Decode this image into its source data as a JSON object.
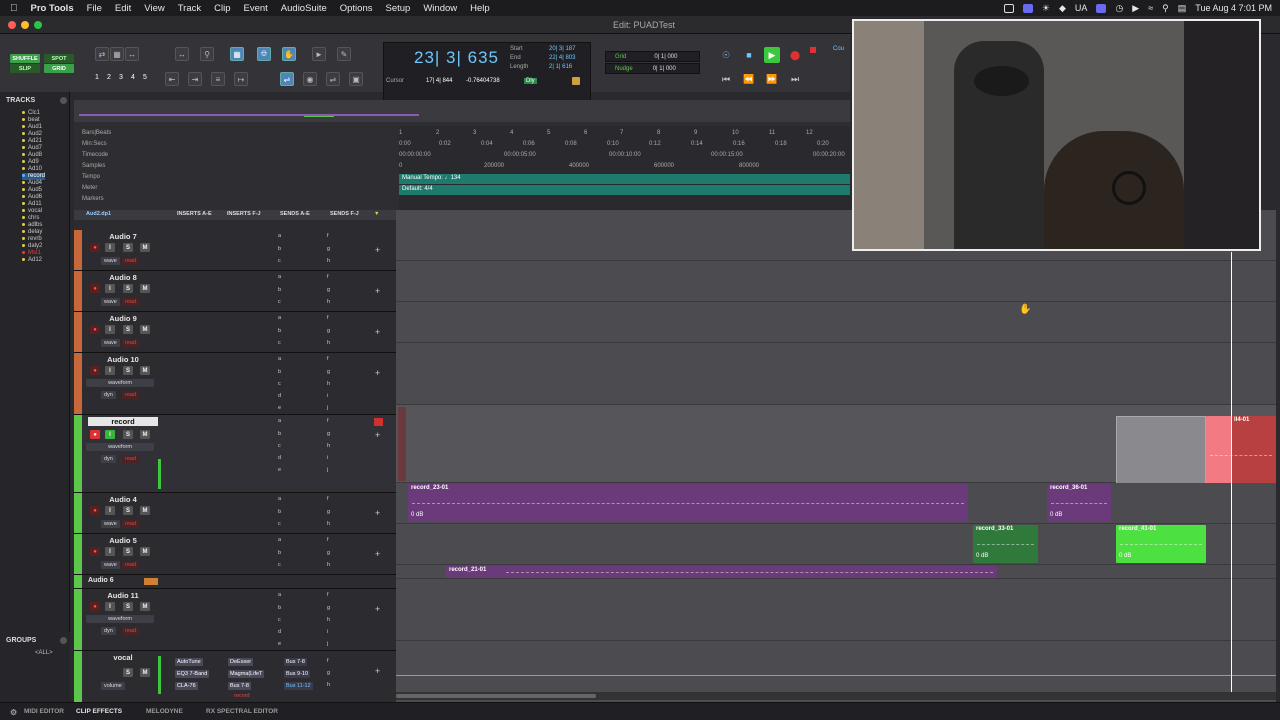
{
  "menubar": {
    "app": "Pro Tools",
    "items": [
      "File",
      "Edit",
      "View",
      "Track",
      "Clip",
      "Event",
      "AudioSuite",
      "Options",
      "Setup",
      "Window",
      "Help"
    ],
    "locale": "UA",
    "clock": "Tue Aug 4  7:01 PM"
  },
  "window": {
    "title": "Edit: PUADTest"
  },
  "toolbar": {
    "modes": [
      "SHUFFLE",
      "SPOT",
      "SLIP",
      "GRID"
    ],
    "zoom_presets": [
      "1",
      "2",
      "3",
      "4",
      "5"
    ],
    "main_counter": "23| 3| 635",
    "sel_labels": [
      "Start",
      "End",
      "Length"
    ],
    "sel_values": [
      "20| 3| 187",
      "22| 4| 803",
      "2| 1| 616"
    ],
    "cursor_label": "Cursor",
    "cursor_value": "17| 4| 844",
    "cursor_db": "-0.76404738",
    "dly": "Dly",
    "grid_label": "Grid",
    "grid_value": "0| 1| 000",
    "nudge_label": "Nudge",
    "nudge_value": "0| 1| 000",
    "cou": "Cou"
  },
  "tracks_list": {
    "header": "TRACKS",
    "items": [
      {
        "name": "Clc1",
        "color": "#e0d040"
      },
      {
        "name": "beat",
        "color": "#e0d040"
      },
      {
        "name": "Aud1",
        "color": "#e0d040"
      },
      {
        "name": "Aud2",
        "color": "#e0d040"
      },
      {
        "name": "Ad21",
        "color": "#e0d040"
      },
      {
        "name": "Aud7",
        "color": "#e0d040"
      },
      {
        "name": "Aud8",
        "color": "#e0d040"
      },
      {
        "name": "Ad9",
        "color": "#e0d040"
      },
      {
        "name": "Ad10",
        "color": "#e0d040"
      },
      {
        "name": "record",
        "color": "#5ab0ff"
      },
      {
        "name": "Aud4",
        "color": "#e0d040"
      },
      {
        "name": "Aud5",
        "color": "#e0d040"
      },
      {
        "name": "Aud6",
        "color": "#e0d040"
      },
      {
        "name": "Ad11",
        "color": "#e0d040"
      },
      {
        "name": "vocal",
        "color": "#e0d040"
      },
      {
        "name": "chrs",
        "color": "#e0d040"
      },
      {
        "name": "adlbs",
        "color": "#e0d040"
      },
      {
        "name": "delay",
        "color": "#e0d040"
      },
      {
        "name": "revrb",
        "color": "#e0d040"
      },
      {
        "name": "daly2",
        "color": "#e0d040"
      },
      {
        "name": "Mst1",
        "color": "#e04040"
      },
      {
        "name": "Ad12",
        "color": "#e0d040"
      }
    ]
  },
  "groups": {
    "header": "GROUPS",
    "all": "<ALL>"
  },
  "rulers": {
    "rows": [
      "Bars|Beats",
      "Min:Secs",
      "Timecode",
      "Samples",
      "Tempo",
      "Meter",
      "Markers"
    ],
    "bars": [
      "1",
      "2",
      "3",
      "4",
      "5",
      "6",
      "7",
      "8",
      "9",
      "10",
      "11",
      "12"
    ],
    "mins": [
      "0:00",
      "0:02",
      "0:04",
      "0:06",
      "0:08",
      "0:10",
      "0:12",
      "0:14",
      "0:16",
      "0:18",
      "0:20"
    ],
    "timecode": [
      "00:00:00:00",
      "00:00:05:00",
      "00:00:10:00",
      "00:00:15:00",
      "00:00:20:00"
    ],
    "samples": [
      "0",
      "200000",
      "400000",
      "600000",
      "800000"
    ],
    "tempo": "Manual Tempo: ♩134",
    "meter": "Default: 4/4"
  },
  "columns": {
    "track_header": "Aud2.dp1",
    "inserts_ae": "INSERTS A-E",
    "inserts_fj": "INSERTS F-J",
    "sends_ae": "SENDS A-E",
    "sends_fj": "SENDS F-J"
  },
  "tracks": [
    {
      "name": "Audio 7",
      "color": "#c8683a",
      "view": "wave",
      "mode": "read"
    },
    {
      "name": "Audio 8",
      "color": "#c8683a",
      "view": "wave",
      "mode": "read"
    },
    {
      "name": "Audio 9",
      "color": "#c8683a",
      "view": "wave",
      "mode": "read"
    },
    {
      "name": "Audio 10",
      "color": "#c8683a",
      "view": "waveform",
      "dyn": "dyn",
      "mode": "read"
    },
    {
      "name": "record",
      "color": "#5cc84a",
      "view": "waveform",
      "dyn": "dyn",
      "mode": "read"
    },
    {
      "name": "Audio 4",
      "color": "#5cc84a",
      "view": "wave",
      "mode": "read"
    },
    {
      "name": "Audio 5",
      "color": "#5cc84a",
      "view": "wave",
      "mode": "read"
    },
    {
      "name": "Audio 6",
      "color": "#5cc84a",
      "view": "",
      "mode": ""
    },
    {
      "name": "Audio 11",
      "color": "#5cc84a",
      "view": "waveform",
      "dyn": "dyn",
      "mode": "read"
    },
    {
      "name": "vocal",
      "color": "#5cc84a",
      "view": "volume",
      "mode": ""
    }
  ],
  "vocal_inserts": [
    "AutoTune",
    "EQ3 7-Band",
    "CLA-76"
  ],
  "vocal_inserts_fj": [
    "DeEsser",
    "Magma(LifeT",
    "Bus 7-8"
  ],
  "vocal_sends": [
    "Bus 7-8",
    "Bus 9-10",
    "Bus 11-12"
  ],
  "send_letters": [
    "a",
    "b",
    "c",
    "d",
    "e"
  ],
  "send_letters_fj": [
    "f",
    "g",
    "h",
    "i",
    "j"
  ],
  "vocal_footer": "record",
  "clips": [
    {
      "name": "record_23-01",
      "db": "0 dB",
      "color": "#6a3a7a"
    },
    {
      "name": "record_36-01",
      "db": "0 dB",
      "color": "#6a3a7a"
    },
    {
      "name": "record_33-01",
      "db": "0 dB",
      "color": "#2f7a3a"
    },
    {
      "name": "record_41-01",
      "db": "0 dB",
      "color": "#4ce040"
    },
    {
      "name": "record_21-01",
      "db": "",
      "color": "#6a3a7a"
    },
    {
      "name": "ll4-01",
      "db": "",
      "color": "#b84040"
    }
  ],
  "bottom_tabs": [
    "MIDI EDITOR",
    "CLIP EFFECTS",
    "MELODYNE",
    "RX SPECTRAL EDITOR"
  ]
}
